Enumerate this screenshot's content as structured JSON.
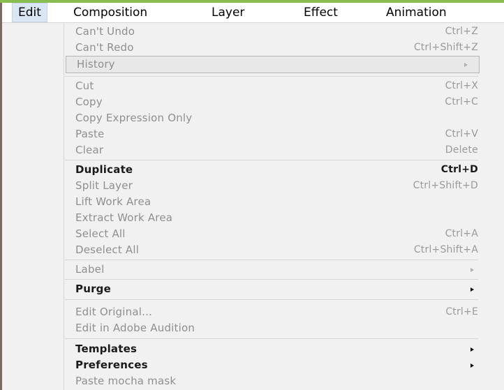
{
  "menubar": {
    "items": [
      "Edit",
      "Composition",
      "Layer",
      "Effect",
      "Animation"
    ]
  },
  "menu": {
    "undo": {
      "label": "Can't Undo",
      "shortcut": "Ctrl+Z"
    },
    "redo": {
      "label": "Can't Redo",
      "shortcut": "Ctrl+Shift+Z"
    },
    "history": {
      "label": "History",
      "submenu_icon": "submenu-arrow-icon"
    },
    "cut": {
      "label": "Cut",
      "shortcut": "Ctrl+X"
    },
    "copy": {
      "label": "Copy",
      "shortcut": "Ctrl+C"
    },
    "copy_expression_only": {
      "label": "Copy Expression Only"
    },
    "paste": {
      "label": "Paste",
      "shortcut": "Ctrl+V"
    },
    "clear": {
      "label": "Clear",
      "shortcut": "Delete"
    },
    "duplicate": {
      "label": "Duplicate",
      "shortcut": "Ctrl+D"
    },
    "split_layer": {
      "label": "Split Layer",
      "shortcut": "Ctrl+Shift+D"
    },
    "lift_work_area": {
      "label": "Lift Work Area"
    },
    "extract_work_area": {
      "label": "Extract Work Area"
    },
    "select_all": {
      "label": "Select All",
      "shortcut": "Ctrl+A"
    },
    "deselect_all": {
      "label": "Deselect All",
      "shortcut": "Ctrl+Shift+A"
    },
    "label": {
      "label": "Label",
      "submenu_icon": "submenu-arrow-icon"
    },
    "purge": {
      "label": "Purge",
      "submenu_icon": "submenu-arrow-icon"
    },
    "edit_original": {
      "label": "Edit Original...",
      "shortcut": "Ctrl+E"
    },
    "edit_in_audition": {
      "label": "Edit in Adobe Audition"
    },
    "templates": {
      "label": "Templates",
      "submenu_icon": "submenu-arrow-icon"
    },
    "preferences": {
      "label": "Preferences",
      "submenu_icon": "submenu-arrow-icon"
    },
    "paste_mocha_mask": {
      "label": "Paste mocha mask"
    }
  },
  "colors": {
    "accent_green": "#88bd52",
    "active_menu": "#dbe6f4",
    "enabled_text": "#1a1a1a",
    "disabled_text": "#8f8f8f"
  }
}
